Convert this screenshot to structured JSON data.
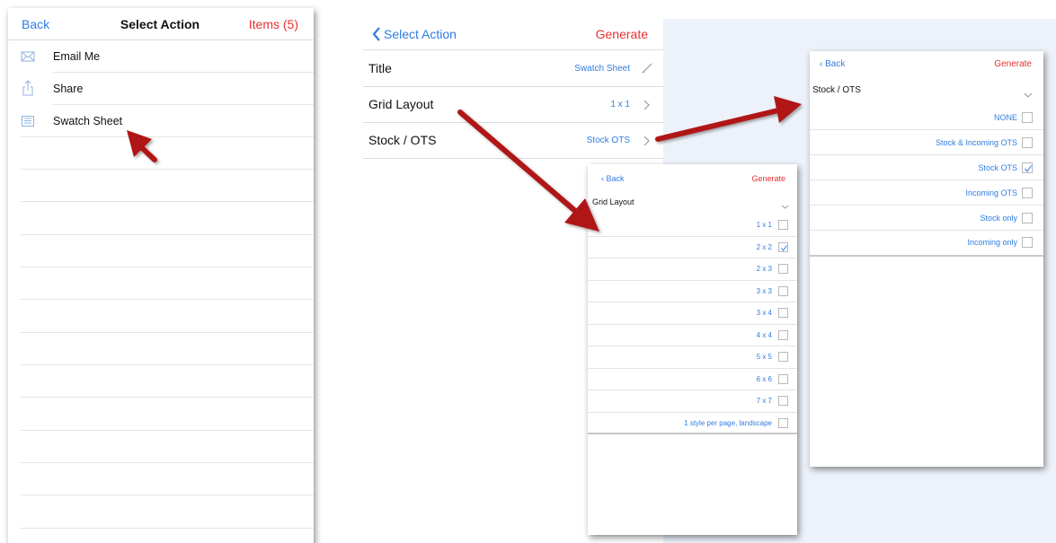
{
  "panel1": {
    "back_label": "Back",
    "title": "Select Action",
    "items_label": "Items (5)",
    "actions": [
      {
        "label": "Email Me",
        "icon": "envelope-icon"
      },
      {
        "label": "Share",
        "icon": "share-icon"
      },
      {
        "label": "Swatch Sheet",
        "icon": "list-icon"
      }
    ]
  },
  "panel2": {
    "back_label": "Select Action",
    "generate_label": "Generate",
    "rows": [
      {
        "label": "Title",
        "value": "Swatch Sheet",
        "icon": "pencil-icon"
      },
      {
        "label": "Grid Layout",
        "value": "1 x 1",
        "icon": "chevron-right-icon"
      },
      {
        "label": "Stock / OTS",
        "value": "Stock OTS",
        "icon": "chevron-right-icon"
      }
    ]
  },
  "panel3": {
    "back_label": "‹ Back",
    "generate_label": "Generate",
    "section_label": "Grid Layout",
    "options": [
      {
        "label": "1 x 1",
        "checked": false
      },
      {
        "label": "2 x 2",
        "checked": true
      },
      {
        "label": "2 x 3",
        "checked": false
      },
      {
        "label": "3 x 3",
        "checked": false
      },
      {
        "label": "3 x 4",
        "checked": false
      },
      {
        "label": "4 x 4",
        "checked": false
      },
      {
        "label": "5 x 5",
        "checked": false
      },
      {
        "label": "6 x 6",
        "checked": false
      },
      {
        "label": "7 x 7",
        "checked": false
      },
      {
        "label": "1 style per page, landscape",
        "checked": false
      }
    ]
  },
  "panel4": {
    "back_label": "‹ Back",
    "generate_label": "Generate",
    "section_label": "Stock / OTS",
    "options": [
      {
        "label": "NONE",
        "checked": false
      },
      {
        "label": "Stock & Incoming OTS",
        "checked": false
      },
      {
        "label": "Stock OTS",
        "checked": true
      },
      {
        "label": "Incoming OTS",
        "checked": false
      },
      {
        "label": "Stock only",
        "checked": false
      },
      {
        "label": "Incoming only",
        "checked": false
      }
    ]
  },
  "colors": {
    "accent_blue": "#2f7de1",
    "accent_red": "#e53030",
    "annotation_arrow": "#b01818",
    "backdrop": "#edf2fa"
  }
}
